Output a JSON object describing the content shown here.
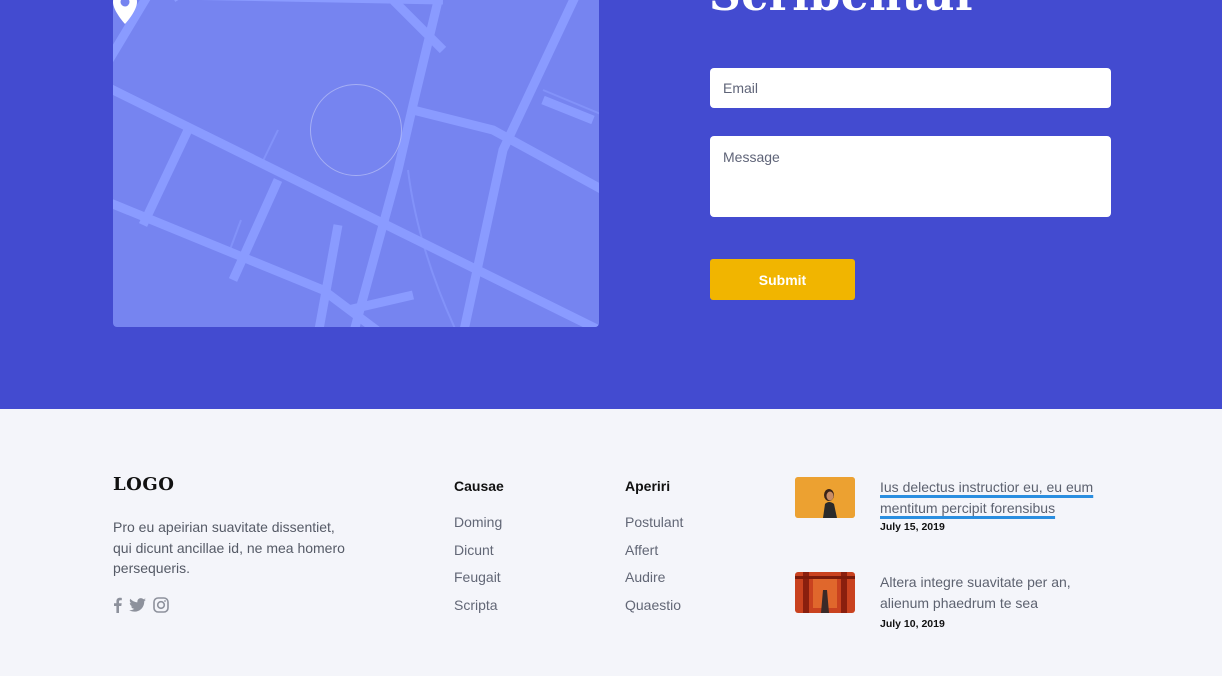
{
  "contact": {
    "heading": "Scribentur",
    "email_placeholder": "Email",
    "message_placeholder": "Message",
    "submit_label": "Submit"
  },
  "footer": {
    "logo": "LOGO",
    "description": "Pro eu apeirian suavitate dissentiet, qui dicunt ancillae id, ne mea homero persequeris.",
    "social": [
      {
        "icon": "facebook-icon"
      },
      {
        "icon": "twitter-icon"
      },
      {
        "icon": "instagram-icon"
      }
    ],
    "columns": [
      {
        "title": "Causae",
        "links": [
          "Doming",
          "Dicunt",
          "Feugait",
          "Scripta"
        ]
      },
      {
        "title": "Aperiri",
        "links": [
          "Postulant",
          "Affert",
          "Audire",
          "Quaestio"
        ]
      }
    ],
    "posts": [
      {
        "text": "Ius delectus instructior eu, eu eum mentitum percipit forensibus",
        "date": "July 15, 2019"
      },
      {
        "text": "Altera integre suavitate per an, alienum phaedrum te sea",
        "date": "July 10, 2019"
      }
    ]
  },
  "colors": {
    "contact_bg": "#434bd0",
    "map_bg": "#7684f0",
    "submit_bg": "#f1b500",
    "footer_bg": "#f4f5fa"
  }
}
